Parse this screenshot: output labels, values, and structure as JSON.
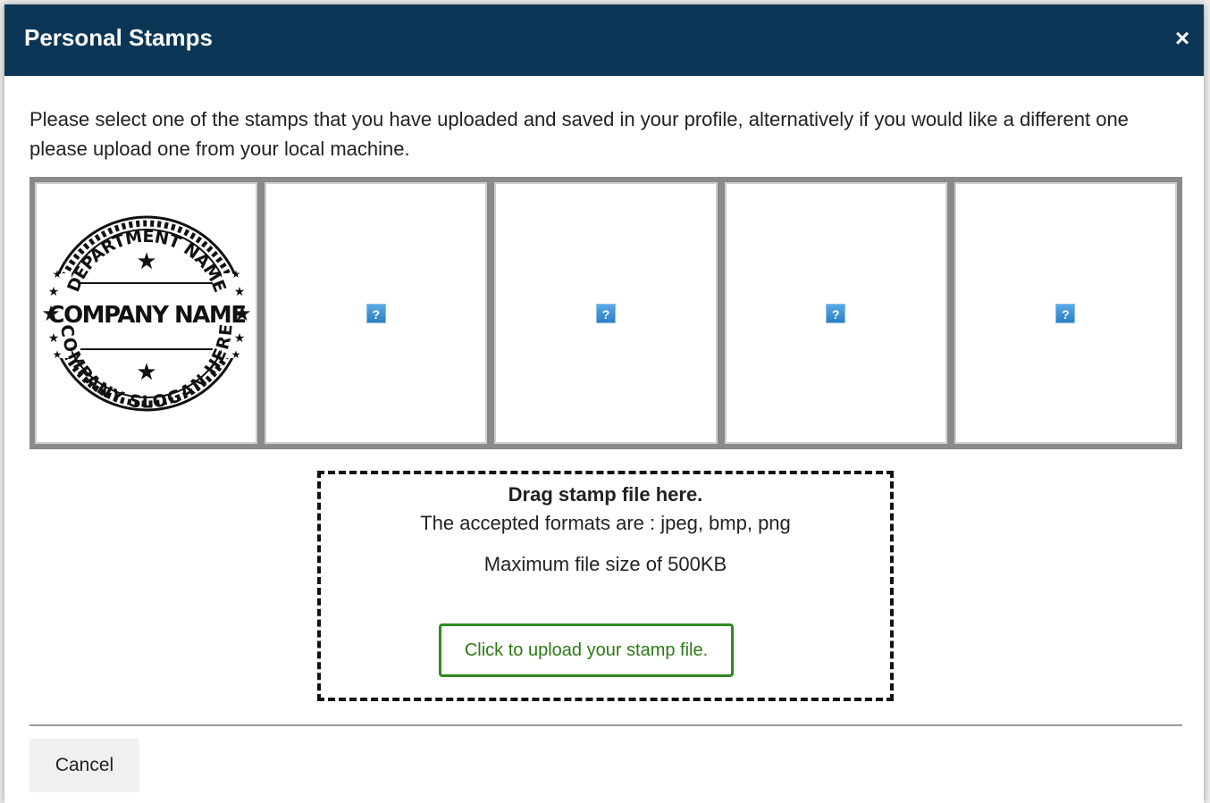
{
  "dialog": {
    "title": "Personal Stamps",
    "close_symbol": "×",
    "instructions": "Please select one of the stamps that you have uploaded and saved in your profile, alternatively if you would like a different one please upload one from your local machine."
  },
  "stamps": {
    "slots": [
      {
        "kind": "image",
        "image_text": {
          "top_arc": "DEPARTMENT NAME",
          "center": "COMPANY NAME",
          "bottom_arc": "COMPANY SLOGAN HERE"
        }
      },
      {
        "kind": "broken",
        "icon": "broken-image-icon",
        "glyph": "?"
      },
      {
        "kind": "broken",
        "icon": "broken-image-icon",
        "glyph": "?"
      },
      {
        "kind": "broken",
        "icon": "broken-image-icon",
        "glyph": "?"
      },
      {
        "kind": "broken",
        "icon": "broken-image-icon",
        "glyph": "?"
      }
    ]
  },
  "dropzone": {
    "title": "Drag stamp file here.",
    "formats": "The accepted formats are : jpeg, bmp, png",
    "max_size": "Maximum file size of 500KB",
    "upload_label": "Click to upload your stamp file."
  },
  "footer": {
    "cancel_label": "Cancel"
  },
  "colors": {
    "header_bg": "#0b3656",
    "upload_accent": "#2f8a1f"
  }
}
